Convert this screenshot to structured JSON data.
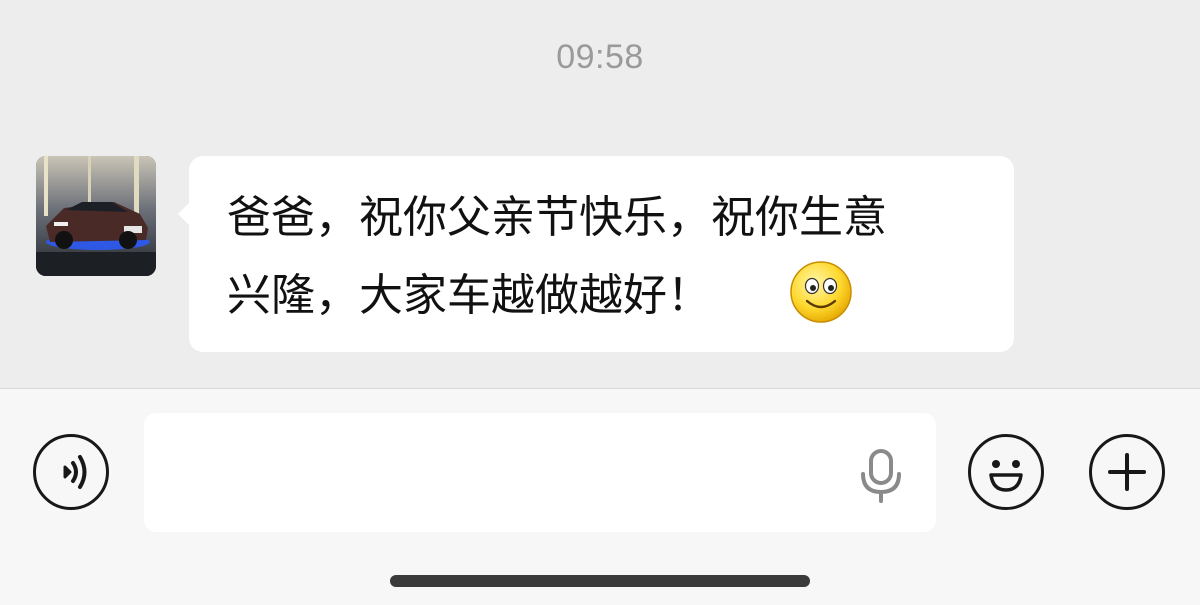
{
  "chat": {
    "timestamp": "09:58",
    "messages": [
      {
        "sender": "contact",
        "avatar_icon": "car-photo-avatar",
        "lines": [
          "爸爸，祝你父亲节快乐，祝你生意",
          "兴隆，大家车越做越好！"
        ],
        "emoji": "smiley-icon"
      }
    ]
  },
  "input_bar": {
    "voice_icon": "voice-mode-icon",
    "text_value": "",
    "mic_icon": "microphone-icon",
    "emoji_icon": "emoji-icon",
    "plus_icon": "plus-icon"
  },
  "colors": {
    "chat_background": "#ededed",
    "bubble": "#ffffff",
    "input_bar_background": "#f7f7f7",
    "icon_stroke": "#181818",
    "timestamp_text": "#9a9a9a"
  }
}
